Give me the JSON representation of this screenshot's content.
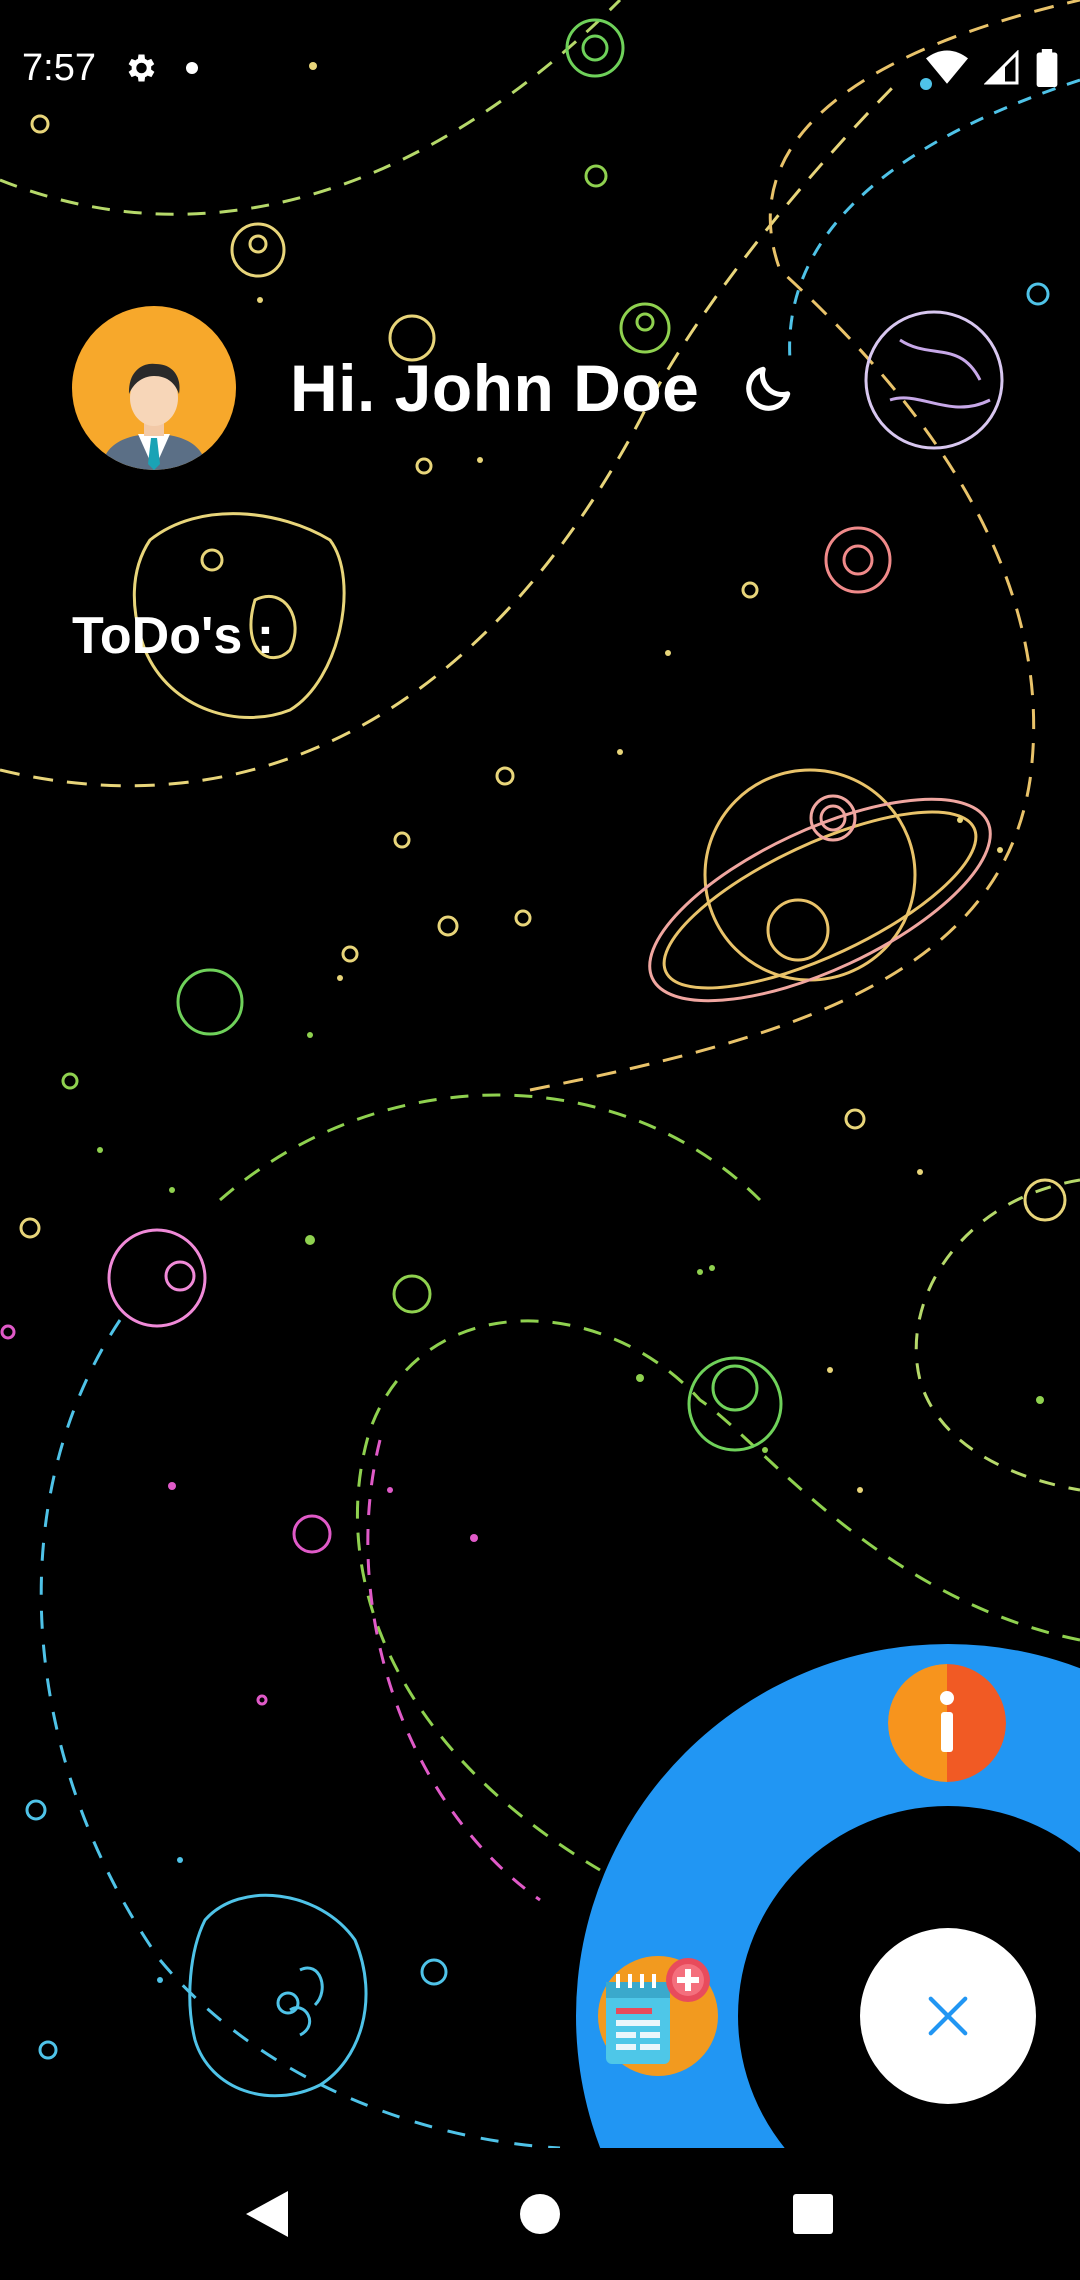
{
  "status_bar": {
    "time": "7:57",
    "icons": [
      "settings-icon",
      "notification-dot-icon",
      "wifi-icon",
      "signal-icon",
      "battery-icon"
    ]
  },
  "header": {
    "greeting": "Hi. John Doe",
    "avatar": "avatar-man-icon",
    "theme_toggle": "moon-icon"
  },
  "todos": {
    "label": "ToDo's :",
    "items": []
  },
  "fab_menu": {
    "info_button": "info-icon",
    "add_button": "add-note-icon",
    "close_button": "close-icon"
  },
  "nav_bar": {
    "buttons": [
      "back-icon",
      "home-icon",
      "recents-icon"
    ]
  },
  "colors": {
    "background": "#000000",
    "fab_ring": "#2196f3",
    "avatar_bg": "#f7a82b",
    "close_x": "#2196f3",
    "info_left": "#f7941d",
    "info_right": "#f15a24"
  }
}
